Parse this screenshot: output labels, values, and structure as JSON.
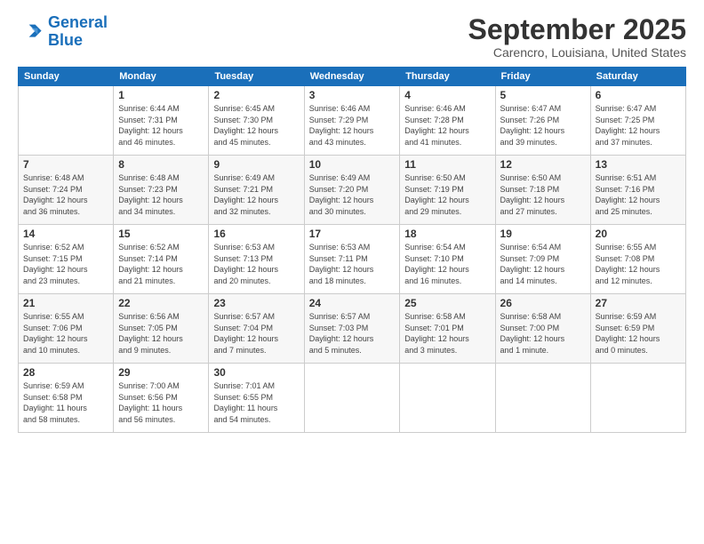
{
  "logo": {
    "line1": "General",
    "line2": "Blue"
  },
  "header": {
    "title": "September 2025",
    "subtitle": "Carencro, Louisiana, United States"
  },
  "days_of_week": [
    "Sunday",
    "Monday",
    "Tuesday",
    "Wednesday",
    "Thursday",
    "Friday",
    "Saturday"
  ],
  "weeks": [
    [
      {
        "day": "",
        "info": ""
      },
      {
        "day": "1",
        "info": "Sunrise: 6:44 AM\nSunset: 7:31 PM\nDaylight: 12 hours\nand 46 minutes."
      },
      {
        "day": "2",
        "info": "Sunrise: 6:45 AM\nSunset: 7:30 PM\nDaylight: 12 hours\nand 45 minutes."
      },
      {
        "day": "3",
        "info": "Sunrise: 6:46 AM\nSunset: 7:29 PM\nDaylight: 12 hours\nand 43 minutes."
      },
      {
        "day": "4",
        "info": "Sunrise: 6:46 AM\nSunset: 7:28 PM\nDaylight: 12 hours\nand 41 minutes."
      },
      {
        "day": "5",
        "info": "Sunrise: 6:47 AM\nSunset: 7:26 PM\nDaylight: 12 hours\nand 39 minutes."
      },
      {
        "day": "6",
        "info": "Sunrise: 6:47 AM\nSunset: 7:25 PM\nDaylight: 12 hours\nand 37 minutes."
      }
    ],
    [
      {
        "day": "7",
        "info": "Sunrise: 6:48 AM\nSunset: 7:24 PM\nDaylight: 12 hours\nand 36 minutes."
      },
      {
        "day": "8",
        "info": "Sunrise: 6:48 AM\nSunset: 7:23 PM\nDaylight: 12 hours\nand 34 minutes."
      },
      {
        "day": "9",
        "info": "Sunrise: 6:49 AM\nSunset: 7:21 PM\nDaylight: 12 hours\nand 32 minutes."
      },
      {
        "day": "10",
        "info": "Sunrise: 6:49 AM\nSunset: 7:20 PM\nDaylight: 12 hours\nand 30 minutes."
      },
      {
        "day": "11",
        "info": "Sunrise: 6:50 AM\nSunset: 7:19 PM\nDaylight: 12 hours\nand 29 minutes."
      },
      {
        "day": "12",
        "info": "Sunrise: 6:50 AM\nSunset: 7:18 PM\nDaylight: 12 hours\nand 27 minutes."
      },
      {
        "day": "13",
        "info": "Sunrise: 6:51 AM\nSunset: 7:16 PM\nDaylight: 12 hours\nand 25 minutes."
      }
    ],
    [
      {
        "day": "14",
        "info": "Sunrise: 6:52 AM\nSunset: 7:15 PM\nDaylight: 12 hours\nand 23 minutes."
      },
      {
        "day": "15",
        "info": "Sunrise: 6:52 AM\nSunset: 7:14 PM\nDaylight: 12 hours\nand 21 minutes."
      },
      {
        "day": "16",
        "info": "Sunrise: 6:53 AM\nSunset: 7:13 PM\nDaylight: 12 hours\nand 20 minutes."
      },
      {
        "day": "17",
        "info": "Sunrise: 6:53 AM\nSunset: 7:11 PM\nDaylight: 12 hours\nand 18 minutes."
      },
      {
        "day": "18",
        "info": "Sunrise: 6:54 AM\nSunset: 7:10 PM\nDaylight: 12 hours\nand 16 minutes."
      },
      {
        "day": "19",
        "info": "Sunrise: 6:54 AM\nSunset: 7:09 PM\nDaylight: 12 hours\nand 14 minutes."
      },
      {
        "day": "20",
        "info": "Sunrise: 6:55 AM\nSunset: 7:08 PM\nDaylight: 12 hours\nand 12 minutes."
      }
    ],
    [
      {
        "day": "21",
        "info": "Sunrise: 6:55 AM\nSunset: 7:06 PM\nDaylight: 12 hours\nand 10 minutes."
      },
      {
        "day": "22",
        "info": "Sunrise: 6:56 AM\nSunset: 7:05 PM\nDaylight: 12 hours\nand 9 minutes."
      },
      {
        "day": "23",
        "info": "Sunrise: 6:57 AM\nSunset: 7:04 PM\nDaylight: 12 hours\nand 7 minutes."
      },
      {
        "day": "24",
        "info": "Sunrise: 6:57 AM\nSunset: 7:03 PM\nDaylight: 12 hours\nand 5 minutes."
      },
      {
        "day": "25",
        "info": "Sunrise: 6:58 AM\nSunset: 7:01 PM\nDaylight: 12 hours\nand 3 minutes."
      },
      {
        "day": "26",
        "info": "Sunrise: 6:58 AM\nSunset: 7:00 PM\nDaylight: 12 hours\nand 1 minute."
      },
      {
        "day": "27",
        "info": "Sunrise: 6:59 AM\nSunset: 6:59 PM\nDaylight: 12 hours\nand 0 minutes."
      }
    ],
    [
      {
        "day": "28",
        "info": "Sunrise: 6:59 AM\nSunset: 6:58 PM\nDaylight: 11 hours\nand 58 minutes."
      },
      {
        "day": "29",
        "info": "Sunrise: 7:00 AM\nSunset: 6:56 PM\nDaylight: 11 hours\nand 56 minutes."
      },
      {
        "day": "30",
        "info": "Sunrise: 7:01 AM\nSunset: 6:55 PM\nDaylight: 11 hours\nand 54 minutes."
      },
      {
        "day": "",
        "info": ""
      },
      {
        "day": "",
        "info": ""
      },
      {
        "day": "",
        "info": ""
      },
      {
        "day": "",
        "info": ""
      }
    ]
  ]
}
